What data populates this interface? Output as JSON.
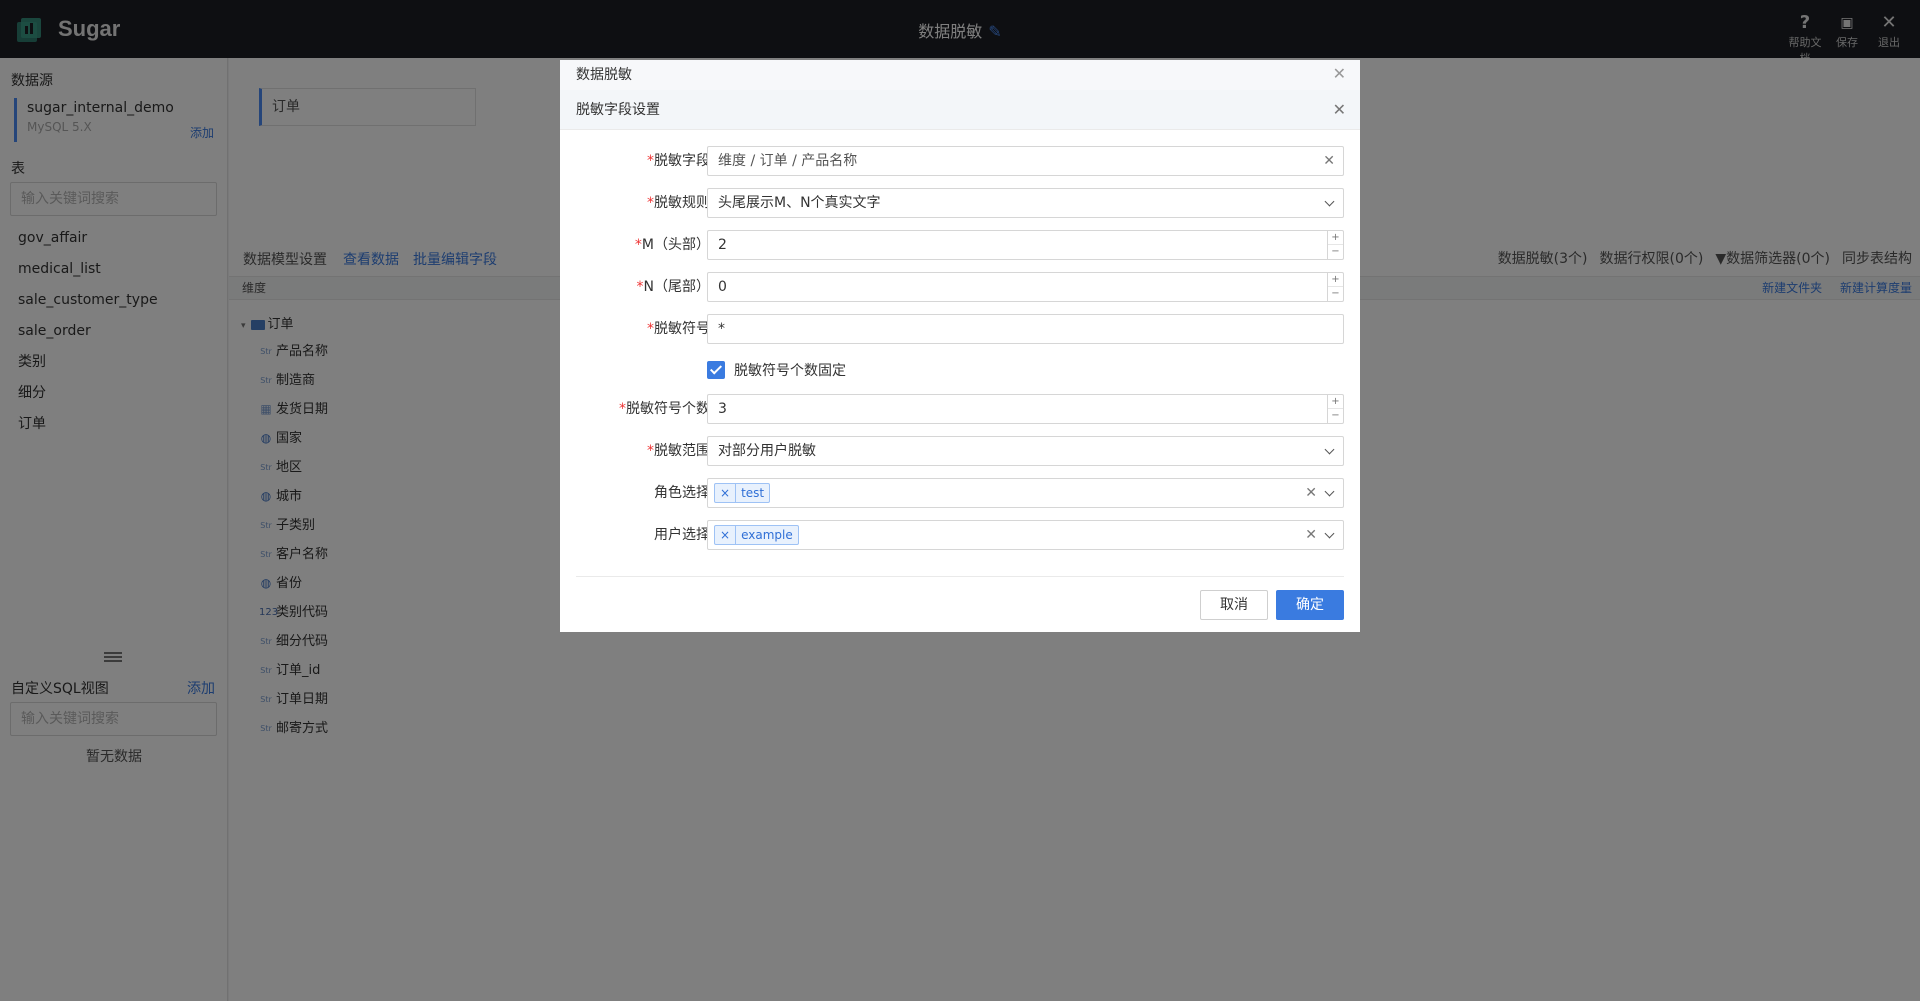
{
  "topbar": {
    "app_name": "Sugar",
    "title": "数据脱敏",
    "actions": [
      {
        "icon": "?",
        "label": "帮助文档"
      },
      {
        "icon": "💾",
        "label": "保存"
      },
      {
        "icon": "✕",
        "label": "退出"
      }
    ]
  },
  "sidebar": {
    "datasource_title": "数据源",
    "datasource_name": "sugar_internal_demo",
    "datasource_version": "MySQL 5.X",
    "datasource_add": "添加",
    "table_title": "表",
    "table_search_placeholder": "输入关键词搜索",
    "tables": [
      "gov_affair",
      "medical_list",
      "sale_customer_type",
      "sale_order",
      "类别",
      "细分",
      "订单"
    ],
    "sql_title": "自定义SQL视图",
    "sql_add": "添加",
    "sql_search_placeholder": "输入关键词搜索",
    "sql_empty": "暂无数据"
  },
  "main": {
    "table_tag": "订单",
    "model_settings": "数据模型设置",
    "view_data": "查看数据",
    "batch_edit": "批量编辑字段",
    "right_links": [
      "数据脱敏(3个)",
      "数据行权限(0个)",
      "数据筛选器(0个)",
      "同步表结构"
    ],
    "dim_header": "维度",
    "new_folder": "新建文件夹",
    "new_measure": "新建计算度量",
    "tree_root": "订单",
    "fields": [
      {
        "type": "Str",
        "name": "产品名称"
      },
      {
        "type": "Str",
        "name": "制造商"
      },
      {
        "type": "date",
        "name": "发货日期"
      },
      {
        "type": "geo",
        "name": "国家"
      },
      {
        "type": "Str",
        "name": "地区"
      },
      {
        "type": "geo",
        "name": "城市"
      },
      {
        "type": "Str",
        "name": "子类别"
      },
      {
        "type": "Str",
        "name": "客户名称"
      },
      {
        "type": "geo",
        "name": "省份"
      },
      {
        "type": "123",
        "name": "类别代码"
      },
      {
        "type": "Str",
        "name": "细分代码"
      },
      {
        "type": "Str",
        "name": "订单_id"
      },
      {
        "type": "Str",
        "name": "订单日期"
      },
      {
        "type": "Str",
        "name": "邮寄方式"
      }
    ]
  },
  "back_dialog": {
    "title": "数据脱敏"
  },
  "dialog": {
    "title": "脱敏字段设置",
    "field_label": "脱敏字段",
    "field_value": "维度 / 订单 / 产品名称",
    "rule_label": "脱敏规则",
    "rule_value": "头尾展示M、N个真实文字",
    "m_label": "M（头部）",
    "m_value": "2",
    "n_label": "N（尾部）",
    "n_value": "0",
    "symbol_label": "脱敏符号",
    "symbol_value": "*",
    "fixed_checkbox_label": "脱敏符号个数固定",
    "fixed_checked": true,
    "count_label": "脱敏符号个数",
    "count_value": "3",
    "scope_label": "脱敏范围",
    "scope_value": "对部分用户脱敏",
    "role_label": "角色选择",
    "role_tags": [
      "test"
    ],
    "user_label": "用户选择",
    "user_tags": [
      "example"
    ],
    "cancel": "取消",
    "ok": "确定"
  },
  "colors": {
    "accent": "#3a7be0",
    "topbar": "#1d1f24",
    "required": "#ee3333"
  }
}
